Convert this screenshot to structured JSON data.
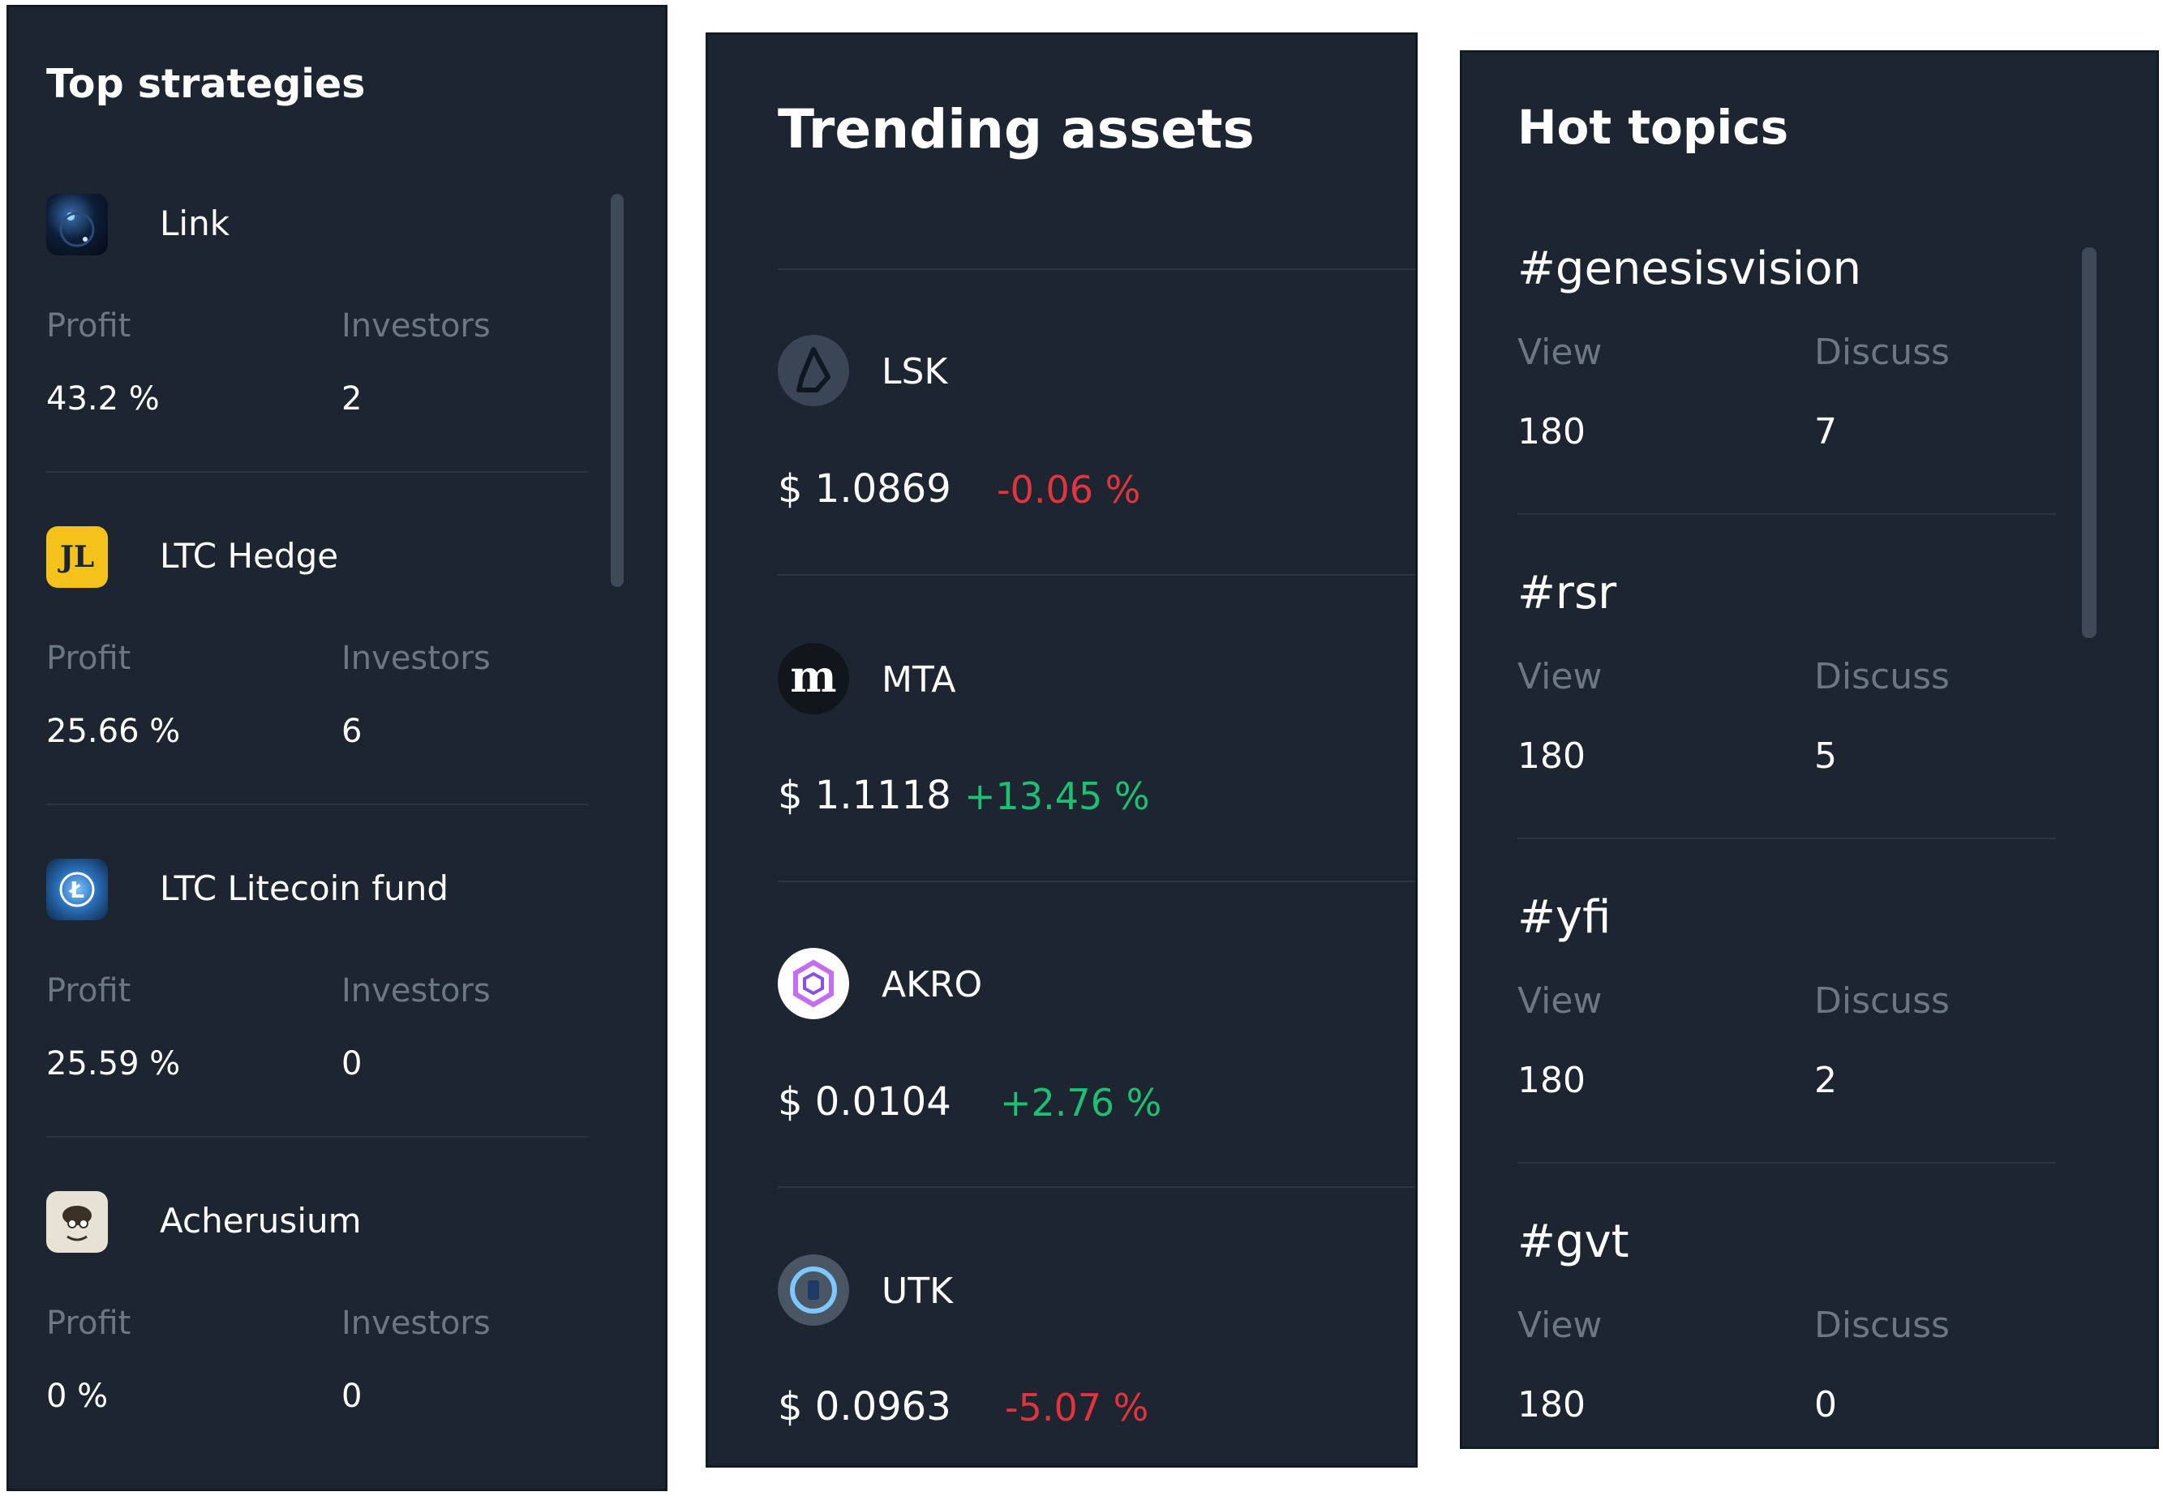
{
  "strategies": {
    "title": "Top strategies",
    "items": [
      {
        "name": "Link",
        "profit_label": "Profit",
        "investors_label": "Investors",
        "profit": "43.2 %",
        "investors": "2",
        "avatar": "planet-avatar-icon"
      },
      {
        "name": "LTC Hedge",
        "profit_label": "Profit",
        "investors_label": "Investors",
        "profit": "25.66 %",
        "investors": "6",
        "avatar": "jl-logo-icon"
      },
      {
        "name": "LTC Litecoin fund",
        "profit_label": "Profit",
        "investors_label": "Investors",
        "profit": "25.59 %",
        "investors": "0",
        "avatar": "litecoin-logo-icon"
      },
      {
        "name": "Acherusium",
        "profit_label": "Profit",
        "investors_label": "Investors",
        "profit": "0 %",
        "investors": "0",
        "avatar": "cartoon-avatar-icon"
      }
    ]
  },
  "assets": {
    "title": "Trending assets",
    "items": [
      {
        "symbol": "LSK",
        "price": "$ 1.0869",
        "change": "-0.06 %",
        "direction": "down",
        "icon": "lisk-icon"
      },
      {
        "symbol": "MTA",
        "price": "$ 1.1118",
        "change": "+13.45 %",
        "direction": "up",
        "icon": "mta-icon",
        "icon_text": "m"
      },
      {
        "symbol": "AKRO",
        "price": "$ 0.0104",
        "change": "+2.76 %",
        "direction": "up",
        "icon": "akro-icon"
      },
      {
        "symbol": "UTK",
        "price": "$ 0.0963",
        "change": "-5.07 %",
        "direction": "down",
        "icon": "utk-icon"
      }
    ]
  },
  "topics": {
    "title": "Hot topics",
    "items": [
      {
        "tag": "#genesisvision",
        "view_label": "View",
        "discuss_label": "Discuss",
        "views": "180",
        "discuss": "7"
      },
      {
        "tag": "#rsr",
        "view_label": "View",
        "discuss_label": "Discuss",
        "views": "180",
        "discuss": "5"
      },
      {
        "tag": "#yfi",
        "view_label": "View",
        "discuss_label": "Discuss",
        "views": "180",
        "discuss": "2"
      },
      {
        "tag": "#gvt",
        "view_label": "View",
        "discuss_label": "Discuss",
        "views": "180",
        "discuss": "0"
      }
    ]
  },
  "colors": {
    "panel_bg": "#1c2530",
    "muted_text": "#6c7784",
    "negative": "#e2343f",
    "positive": "#1fbf73",
    "jl_yellow": "#f4c21b"
  }
}
